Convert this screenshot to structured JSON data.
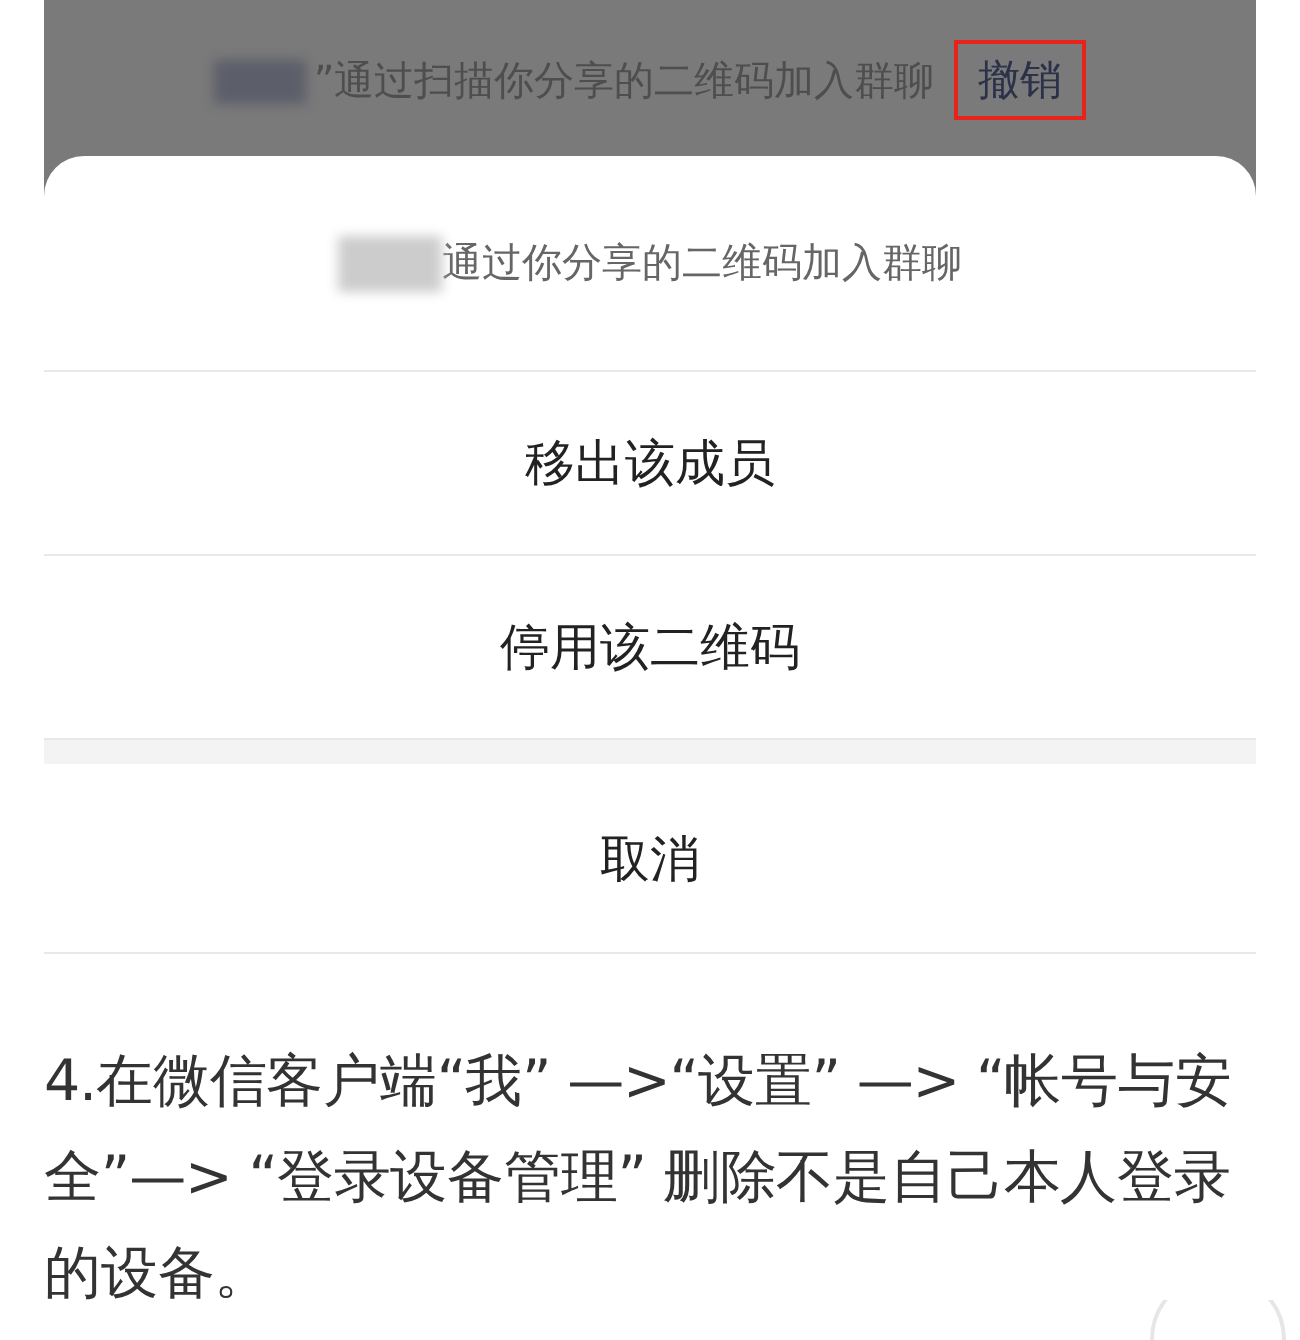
{
  "notification": {
    "text": "”通过扫描你分享的二维码加入群聊",
    "action": "撤销",
    "action_highlighted": true
  },
  "action_sheet": {
    "title": "通过你分享的二维码加入群聊",
    "options": [
      "移出该成员",
      "停用该二维码"
    ],
    "cancel": "取消"
  },
  "article": {
    "paragraph": "4.在微信客户端“我” —>“设置” —> “帐号与安全”—> “登录设备管理” 删除不是自己本人登录的设备。"
  }
}
